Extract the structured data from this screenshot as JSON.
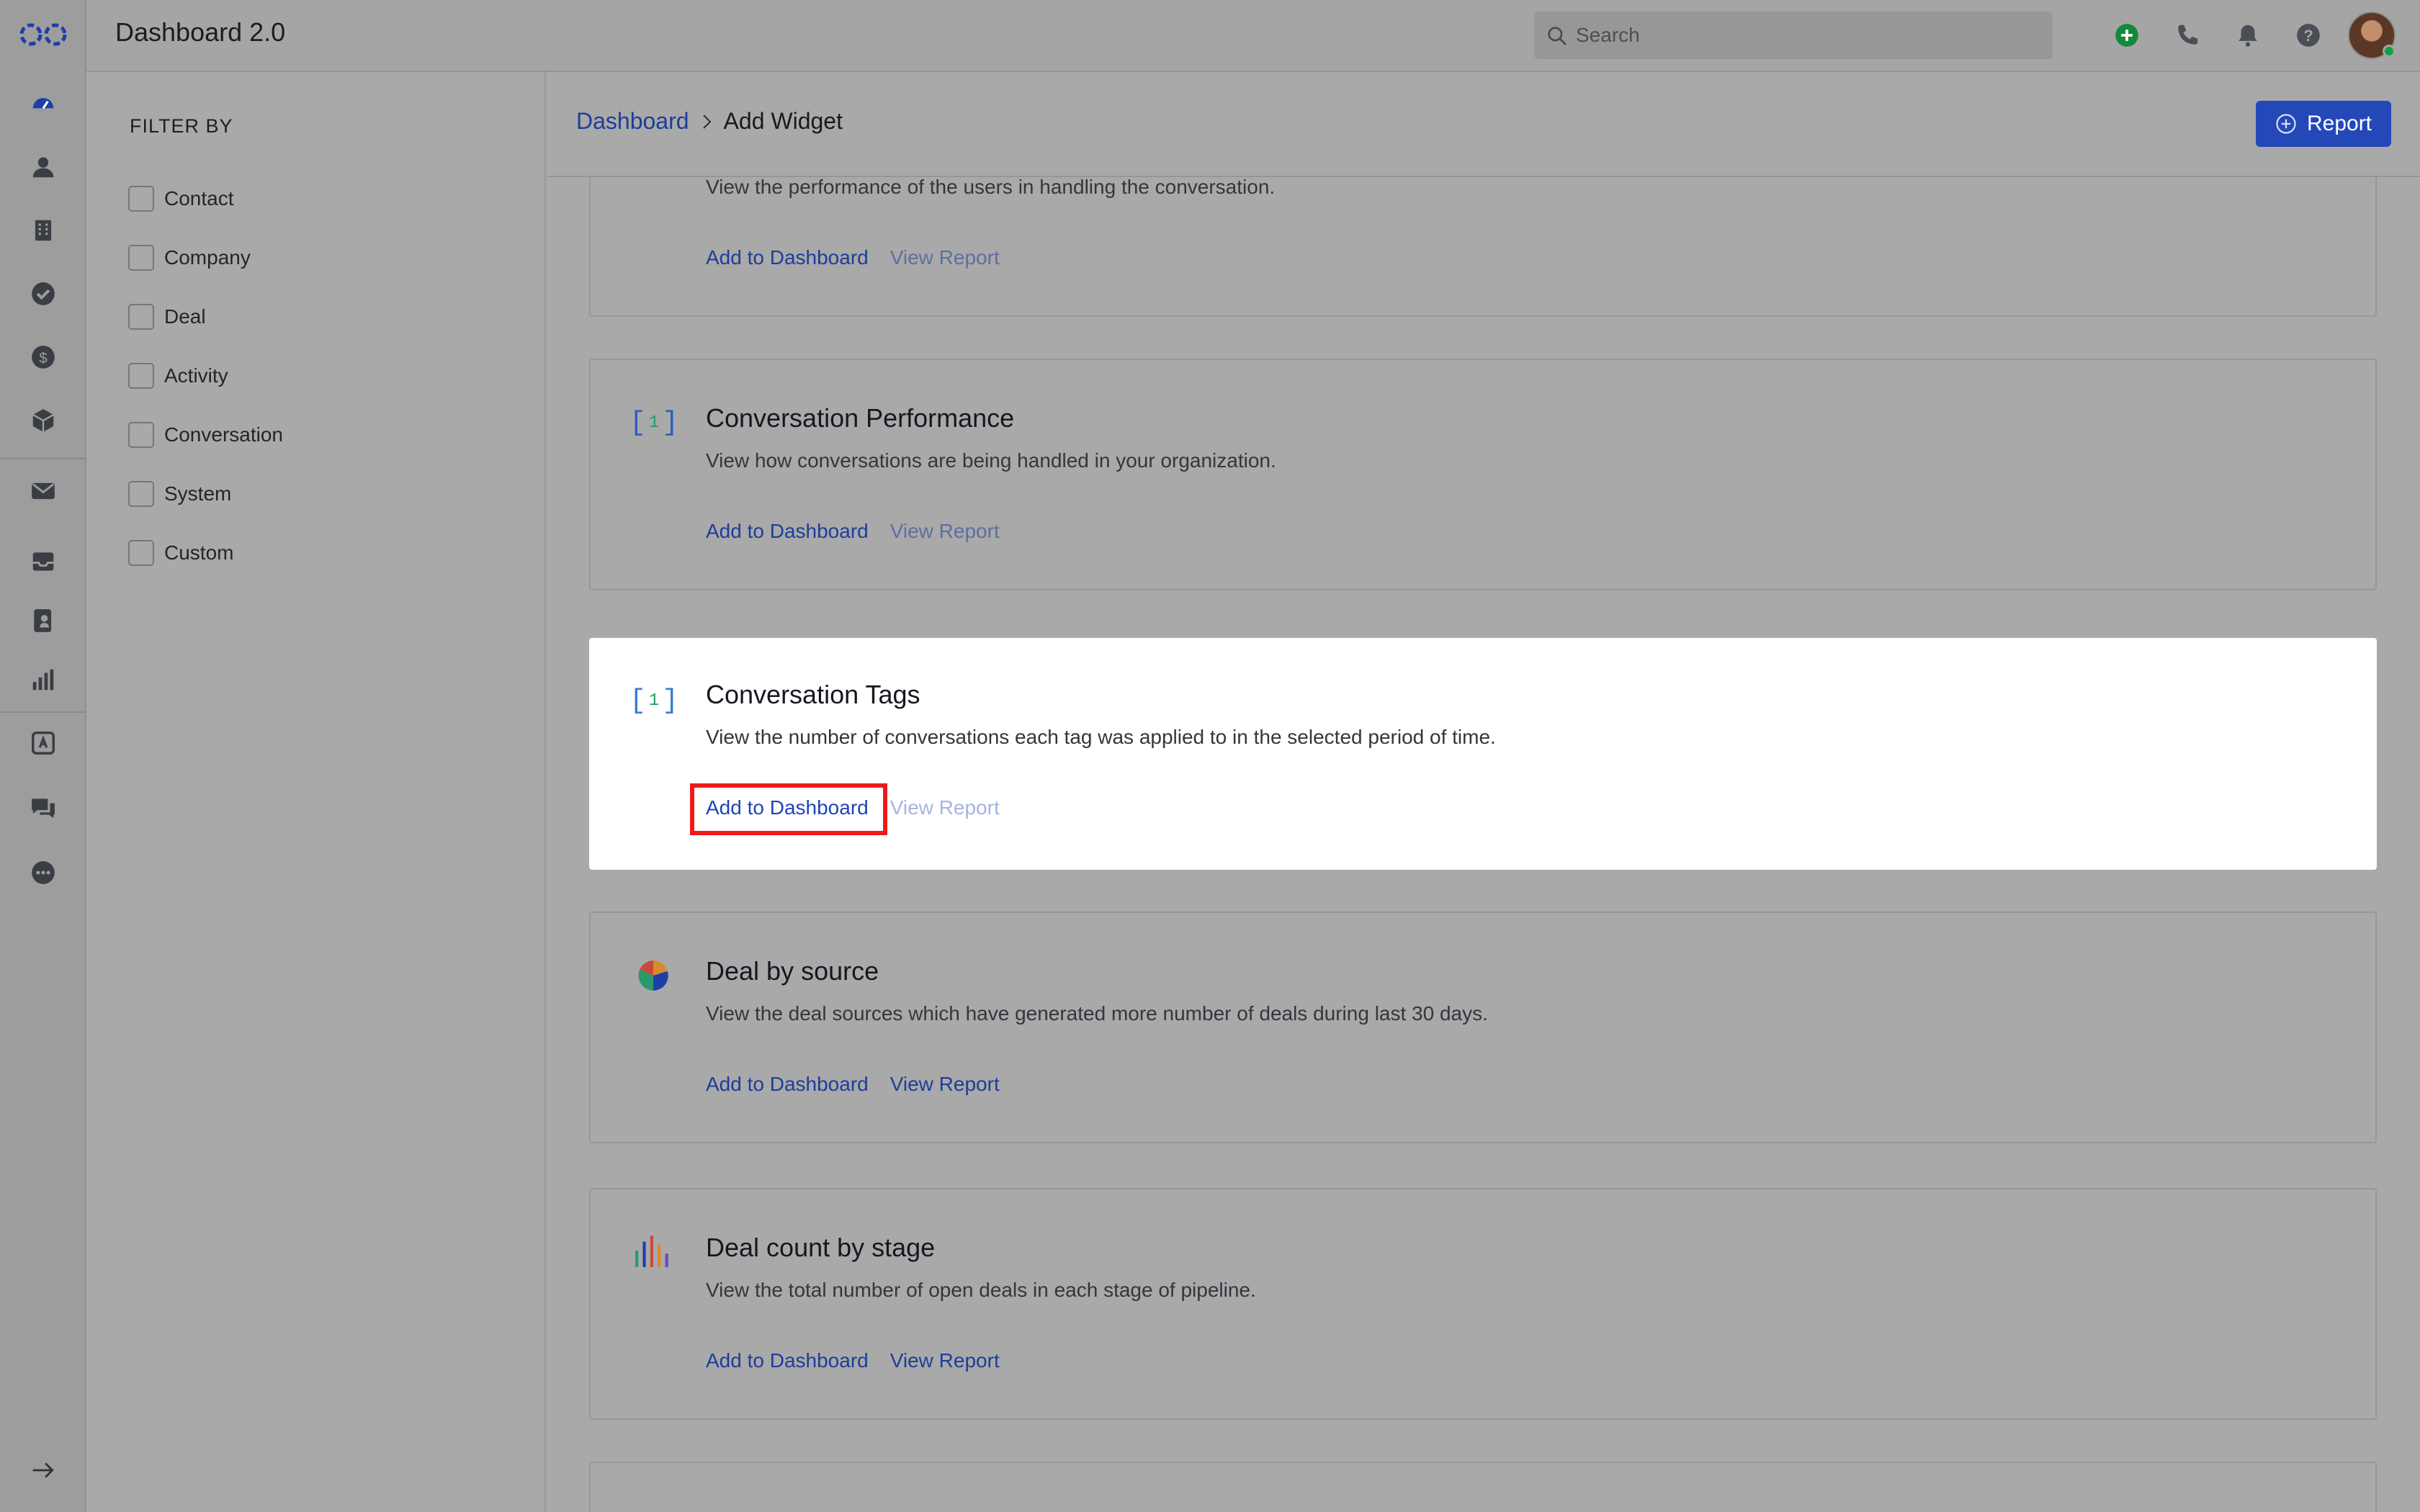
{
  "app": {
    "title": "Dashboard 2.0"
  },
  "search": {
    "placeholder": "Search"
  },
  "filter": {
    "heading": "FILTER BY",
    "options": [
      "Contact",
      "Company",
      "Deal",
      "Activity",
      "Conversation",
      "System",
      "Custom"
    ]
  },
  "breadcrumb": {
    "root": "Dashboard",
    "current": "Add Widget"
  },
  "report_button": {
    "label": "Report"
  },
  "widgets": [
    {
      "title": "",
      "description": "View the performance of the users in handling the conversation.",
      "add_label": "Add to Dashboard",
      "view_label": "View Report",
      "icon": "bracket-counter-icon"
    },
    {
      "title": "Conversation Performance",
      "description": "View how conversations are being handled in your organization.",
      "add_label": "Add to Dashboard",
      "view_label": "View Report",
      "icon": "bracket-counter-icon",
      "counter": "1"
    },
    {
      "title": "Conversation Tags",
      "description": "View the number of conversations each tag was applied to in the selected period of time.",
      "add_label": "Add to Dashboard",
      "view_label": "View Report",
      "icon": "bracket-counter-icon",
      "counter": "1"
    },
    {
      "title": "Deal by source",
      "description": "View the deal sources which have generated more number of deals during last 30 days.",
      "add_label": "Add to Dashboard",
      "view_label": "View Report",
      "icon": "pie-chart-icon"
    },
    {
      "title": "Deal count by stage",
      "description": "View the total number of open deals in each stage of pipeline.",
      "add_label": "Add to Dashboard",
      "view_label": "View Report",
      "icon": "bar-chart-icon"
    }
  ],
  "colors": {
    "accent": "#2448b8",
    "highlight": "#ee1a1a",
    "online": "#10a04a"
  }
}
